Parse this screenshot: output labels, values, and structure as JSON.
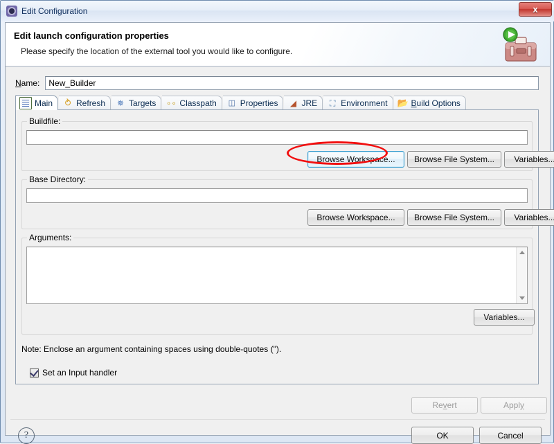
{
  "window": {
    "title": "Edit Configuration",
    "title_icon": "gear-icon",
    "close_label": "x"
  },
  "banner": {
    "title": "Edit launch configuration properties",
    "subtitle": "Please specify the location of the external tool you would like to configure.",
    "icon": "toolbox-with-run-arrow-icon"
  },
  "name_field": {
    "label_mnemonic": "N",
    "label_rest": "ame:",
    "value": "New_Builder",
    "placeholder": ""
  },
  "tabs": [
    {
      "label": "Main",
      "icon": "document-page-icon",
      "selected": true,
      "mnemonic": ""
    },
    {
      "label": "Refresh",
      "icon": "refresh-arrows-icon",
      "selected": false,
      "mnemonic": ""
    },
    {
      "label": "Targets",
      "icon": "targets-ant-icon",
      "selected": false,
      "mnemonic": ""
    },
    {
      "label": "Classpath",
      "icon": "classpath-links-icon",
      "selected": false,
      "mnemonic": ""
    },
    {
      "label": "Properties",
      "icon": "properties-list-icon",
      "selected": false,
      "mnemonic": ""
    },
    {
      "label": "JRE",
      "icon": "jre-books-icon",
      "selected": false,
      "mnemonic": ""
    },
    {
      "label": "Environment",
      "icon": "environment-monitor-icon",
      "selected": false,
      "mnemonic": ""
    },
    {
      "label": "Build Options",
      "icon": "folder-open-icon",
      "selected": false,
      "mnemonic": "B"
    }
  ],
  "buildfile_group": {
    "label": "Buildfile:",
    "value": "",
    "buttons": [
      {
        "label": "Browse Workspace...",
        "focused": true,
        "disabled": false
      },
      {
        "label": "Browse File System...",
        "focused": false,
        "disabled": false
      },
      {
        "label": "Variables...",
        "focused": false,
        "disabled": false
      }
    ]
  },
  "base_directory_group": {
    "label": "Base Directory:",
    "value": "",
    "buttons": [
      {
        "label": "Browse Workspace...",
        "focused": false,
        "disabled": false
      },
      {
        "label": "Browse File System...",
        "focused": false,
        "disabled": false
      },
      {
        "label": "Variables...",
        "focused": false,
        "disabled": false
      }
    ]
  },
  "arguments_group": {
    "label": "Arguments:",
    "value": "",
    "variables_button": "Variables...",
    "scrollbar": {
      "up": "scroll-up-arrow-icon",
      "down": "scroll-down-arrow-icon"
    }
  },
  "note": "Note: Enclose an argument containing spaces using double-quotes (\").",
  "input_handler_checkbox": {
    "label": "Set an Input handler",
    "checked": true
  },
  "action_buttons": {
    "revert": {
      "label_a": "Re",
      "label_mn": "v",
      "label_b": "ert",
      "disabled": true
    },
    "apply": {
      "label_a": "Appl",
      "label_mn": "y",
      "label_b": "",
      "disabled": true
    },
    "ok": {
      "label": "OK",
      "disabled": false
    },
    "cancel": {
      "label": "Cancel",
      "disabled": false
    },
    "help": {
      "label": "?",
      "icon": "help-question-icon"
    }
  },
  "annotation": {
    "target": "Browse Workspace...",
    "shape": "ellipse",
    "color": "#f10f0f"
  }
}
